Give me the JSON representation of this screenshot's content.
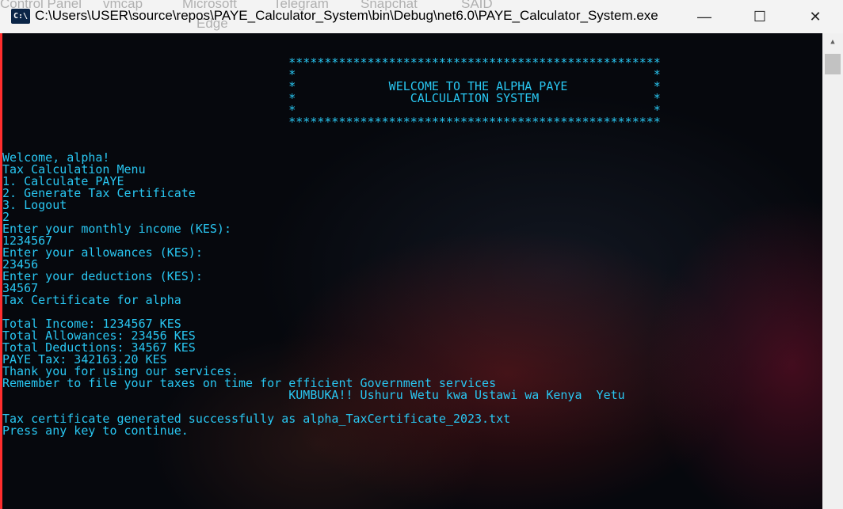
{
  "taskbar_ghost": [
    "Control Panel",
    "vmcap",
    "Microsoft",
    "Telegram",
    "Snapchat",
    "SAID",
    "Edge"
  ],
  "window": {
    "icon_text": "C:\\",
    "title": "C:\\Users\\USER\\source\\repos\\PAYE_Calculator_System\\bin\\Debug\\net6.0\\PAYE_Calculator_System.exe",
    "minimize": "—",
    "maximize": "☐",
    "close": "✕"
  },
  "console": {
    "lines": [
      "",
      "                                                                                  ",
      "                                        ****************************************************",
      "                                        *                                                  *",
      "                                        *             WELCOME TO THE ALPHA PAYE            *",
      "                                        *                CALCULATION SYSTEM                *",
      "                                        *                                                  *",
      "                                        ****************************************************",
      "",
      "",
      "Welcome, alpha!",
      "Tax Calculation Menu",
      "1. Calculate PAYE",
      "2. Generate Tax Certificate",
      "3. Logout",
      "2",
      "Enter your monthly income (KES):",
      "1234567",
      "Enter your allowances (KES):",
      "23456",
      "Enter your deductions (KES):",
      "34567",
      "Tax Certificate for alpha",
      "",
      "Total Income: 1234567 KES",
      "Total Allowances: 23456 KES",
      "Total Deductions: 34567 KES",
      "PAYE Tax: 342163.20 KES",
      "Thank you for using our services.",
      "Remember to file your taxes on time for efficient Government services",
      "                                        KUMBUKA!! Ushuru Wetu kwa Ustawi wa Kenya  Yetu",
      "",
      "Tax certificate generated successfully as alpha_TaxCertificate_2023.txt",
      "Press any key to continue."
    ]
  },
  "colors": {
    "console_text": "#29c7f2",
    "titlebar_bg": "#f3f3f3"
  },
  "icons": {
    "app": "console-app-icon",
    "scroll_up": "scroll-up-arrow-icon"
  }
}
